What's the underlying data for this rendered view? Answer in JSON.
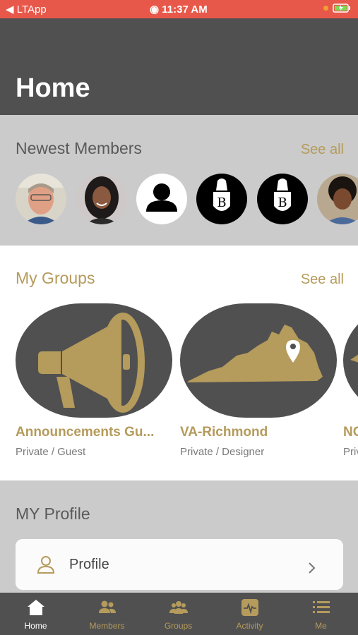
{
  "status": {
    "carrier": "◀ LTApp",
    "time": "11:37 AM"
  },
  "header": {
    "title": "Home"
  },
  "newest_members": {
    "title": "Newest Members",
    "see_all": "See all",
    "avatars": [
      "member-photo-1",
      "member-photo-2",
      "default-user-icon",
      "crest-logo",
      "crest-logo",
      "member-photo-3"
    ]
  },
  "my_groups": {
    "title": "My Groups",
    "see_all": "See all",
    "groups": [
      {
        "name": "Announcements Gu...",
        "sub": "Private / Guest",
        "icon": "megaphone-icon"
      },
      {
        "name": "VA-Richmond",
        "sub": "Private / Designer",
        "icon": "virginia-map-icon"
      },
      {
        "name": "NC",
        "sub": "Priv",
        "icon": "map-icon"
      }
    ]
  },
  "profile": {
    "title": "MY Profile",
    "item_label": "Profile"
  },
  "tabs": [
    {
      "label": "Home",
      "icon": "home-icon",
      "active": true
    },
    {
      "label": "Members",
      "icon": "members-icon"
    },
    {
      "label": "Groups",
      "icon": "groups-icon"
    },
    {
      "label": "Activity",
      "icon": "activity-icon"
    },
    {
      "label": "Me",
      "icon": "menu-icon"
    }
  ],
  "colors": {
    "accent": "#b59b5c",
    "dark": "#505050",
    "status": "#e8584a"
  }
}
